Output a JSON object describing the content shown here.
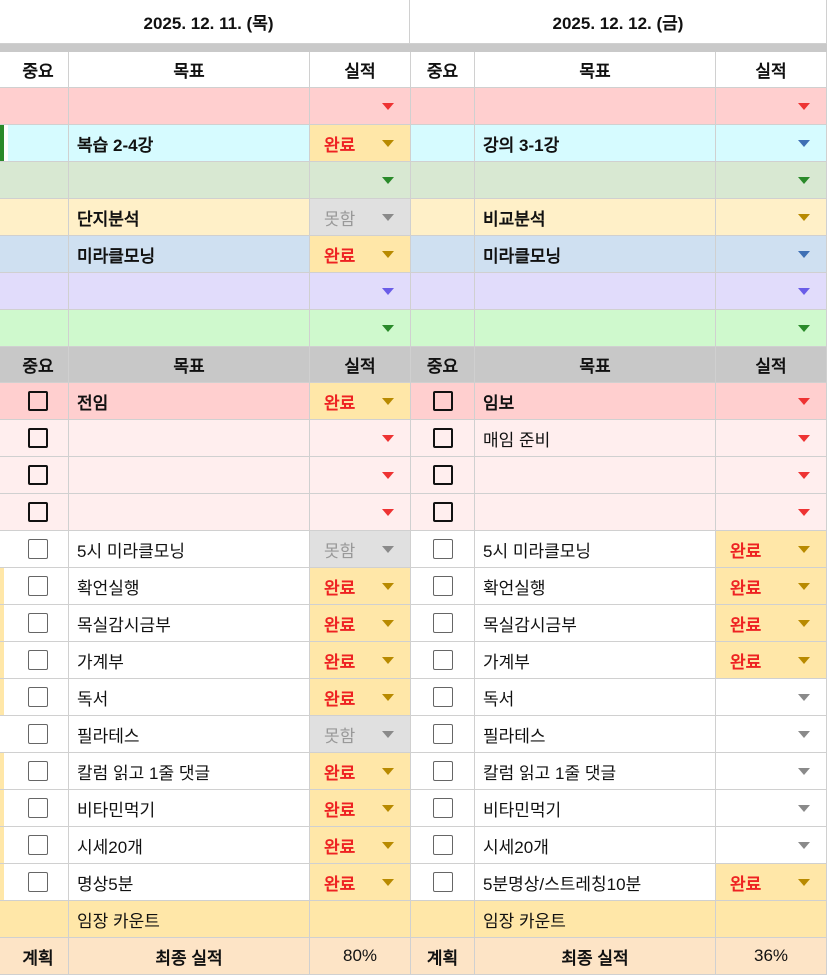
{
  "dates": {
    "day1": "2025. 12. 11. (목)",
    "day2": "2025. 12. 12. (금)"
  },
  "headers": {
    "importance": "중요",
    "goal": "목표",
    "result": "실적"
  },
  "colors": {
    "done_text": "#e22222",
    "header_bg": "#c8c8c8",
    "top_left_marker": "#2a8a2a"
  },
  "top_rows": [
    {
      "color": "pink",
      "arrow": "red",
      "d1_goal": "",
      "d1_result": "",
      "d1_result_style": "",
      "d2_goal": "",
      "d2_result": "",
      "d2_result_style": ""
    },
    {
      "color": "cyan",
      "arrow": "blu",
      "d1_goal": "복습 2-4강",
      "d1_result": "완료",
      "d1_result_style": "done",
      "d2_goal": "강의 3-1강",
      "d2_result": "",
      "d2_result_style": ""
    },
    {
      "color": "sage",
      "arrow": "green",
      "d1_goal": "",
      "d1_result": "",
      "d1_result_style": "",
      "d2_goal": "",
      "d2_result": "",
      "d2_result_style": ""
    },
    {
      "color": "cream",
      "arrow": "gold-a",
      "d1_goal": "단지분석",
      "d1_result": "못함",
      "d1_result_style": "miss",
      "d2_goal": "비교분석",
      "d2_result": "",
      "d2_result_style": ""
    },
    {
      "color": "blue",
      "arrow": "blu",
      "d1_goal": "미라클모닝",
      "d1_result": "완료",
      "d1_result_style": "done",
      "d2_goal": "미라클모닝",
      "d2_result": "",
      "d2_result_style": ""
    },
    {
      "color": "lav",
      "arrow": "purple",
      "d1_goal": "",
      "d1_result": "",
      "d1_result_style": "",
      "d2_goal": "",
      "d2_result": "",
      "d2_result_style": ""
    },
    {
      "color": "mint",
      "arrow": "green",
      "d1_goal": "",
      "d1_result": "",
      "d1_result_style": "",
      "d2_goal": "",
      "d2_result": "",
      "d2_result_style": ""
    }
  ],
  "task_rows": [
    {
      "bg": "pink",
      "bold": true,
      "d1_goal": "전임",
      "d1_result": "완료",
      "d2_goal": "임보",
      "d2_result": ""
    },
    {
      "bg": "lpink",
      "bold": true,
      "d1_goal": "",
      "d1_result": "",
      "d2_goal": "매임 준비",
      "d2_result": ""
    },
    {
      "bg": "lpink",
      "bold": true,
      "d1_goal": "",
      "d1_result": "",
      "d2_goal": "",
      "d2_result": ""
    },
    {
      "bg": "lpink",
      "bold": true,
      "d1_goal": "",
      "d1_result": "",
      "d2_goal": "",
      "d2_result": ""
    },
    {
      "bg": "white",
      "bold": false,
      "d1_goal": "5시 미라클모닝",
      "d1_result": "못함",
      "d2_goal": "5시 미라클모닝",
      "d2_result": "완료"
    },
    {
      "bg": "white",
      "bold": false,
      "d1_goal": "확언실행",
      "d1_result": "완료",
      "d2_goal": "확언실행",
      "d2_result": "완료"
    },
    {
      "bg": "white",
      "bold": false,
      "d1_goal": "목실감시금부",
      "d1_result": "완료",
      "d2_goal": "목실감시금부",
      "d2_result": "완료"
    },
    {
      "bg": "white",
      "bold": false,
      "d1_goal": "가계부",
      "d1_result": "완료",
      "d2_goal": "가계부",
      "d2_result": "완료"
    },
    {
      "bg": "white",
      "bold": false,
      "d1_goal": "독서",
      "d1_result": "완료",
      "d2_goal": "독서",
      "d2_result": ""
    },
    {
      "bg": "white",
      "bold": false,
      "d1_goal": "필라테스",
      "d1_result": "못함",
      "d2_goal": "필라테스",
      "d2_result": ""
    },
    {
      "bg": "white",
      "bold": false,
      "d1_goal": "칼럼 읽고 1줄 댓글",
      "d1_result": "완료",
      "d2_goal": "칼럼 읽고 1줄 댓글",
      "d2_result": ""
    },
    {
      "bg": "white",
      "bold": false,
      "d1_goal": "비타민먹기",
      "d1_result": "완료",
      "d2_goal": "비타민먹기",
      "d2_result": ""
    },
    {
      "bg": "white",
      "bold": false,
      "d1_goal": "시세20개",
      "d1_result": "완료",
      "d2_goal": "시세20개",
      "d2_result": ""
    },
    {
      "bg": "white",
      "bold": false,
      "d1_goal": "명상5분",
      "d1_result": "완료",
      "d2_goal": "5분명상/스트레칭10분",
      "d2_result": "완료"
    }
  ],
  "count_row": {
    "d1_label": "임장 카운트",
    "d2_label": "임장 카운트"
  },
  "final_row": {
    "plan": "계획",
    "label": "최종 실적",
    "d1_value": "80%",
    "d2_value": "36%"
  }
}
